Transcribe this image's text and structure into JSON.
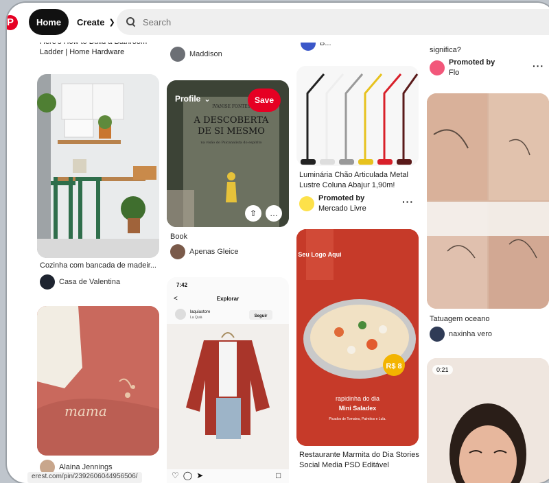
{
  "nav": {
    "home_label": "Home",
    "create_label": "Create",
    "search_placeholder": "Search"
  },
  "pins": {
    "hardware": {
      "title": "Here's How to Build a Bathroom Ladder | Home Hardware"
    },
    "maddison": {
      "author": "Maddison"
    },
    "top_author": {
      "author": "B..."
    },
    "flo": {
      "title": "significa?",
      "promoted": "Promoted by",
      "advertiser": "Flo"
    },
    "kitchen": {
      "title": "Cozinha com bancada de madeir...",
      "author": "Casa de Valentina"
    },
    "book": {
      "profile_label": "Profile",
      "save_label": "Save",
      "book_text_1": "A DESCOBERTA",
      "book_text_2": "DE SI MESMO",
      "book_small": "IVANISE FONTES",
      "book_sub": "na visão do Psicanalista do espírito",
      "title": "Book",
      "author": "Apenas Gleice"
    },
    "lamps": {
      "title": "Luminária Chão Articulada Metal Lustre Coluna Abajur 1,90m!",
      "promoted": "Promoted by",
      "advertiser": "Mercado Livre"
    },
    "tattoo": {
      "title": "Tatuagem oceano",
      "author": "naxinha vero"
    },
    "food": {
      "logo_text": "Seu Logo Aqui",
      "price": "R$ 8",
      "headline": "rapidinha do dia",
      "dish": "Mini Saladex",
      "ingredients": "Picados de Tomates, Palmitos e Lula.",
      "title": "Restaurante Marmita do Dia Stories Social Media PSD Editável"
    },
    "shirt": {
      "time": "7:42",
      "screen_title": "Explorar",
      "store": "laquiastore",
      "store_sub": "La Quià",
      "follow": "Seguir"
    },
    "mama": {
      "embroidery": "mama",
      "author": "Alaina Jennings"
    },
    "video": {
      "duration": "0:21"
    }
  },
  "status_url": "erest.com/pin/2392606044956506/"
}
